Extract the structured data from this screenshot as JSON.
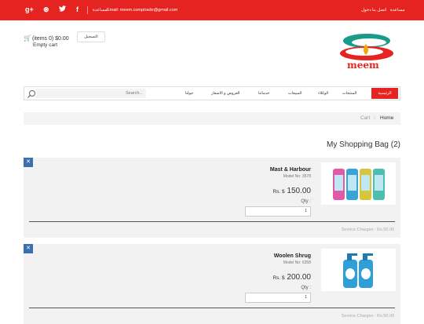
{
  "topbar": {
    "social": [
      {
        "name": "google-plus-icon",
        "glyph": "g+"
      },
      {
        "name": "dribbble-icon",
        "glyph": "⊛"
      },
      {
        "name": "twitter-icon",
        "glyph": "🐦"
      },
      {
        "name": "facebook-icon",
        "glyph": "f"
      }
    ],
    "help_link": "مساعدة",
    "email_link": "Email: meem.comptrade@gmail.com",
    "right_links": [
      "مساعدة",
      "اتصل بنا",
      "دخول"
    ]
  },
  "header": {
    "cart_summary": "(items 0) $0.00",
    "empty_cart": "Empty cart",
    "login_button": "التسجيل",
    "logo_text": "meem"
  },
  "nav": {
    "search_placeholder": "Search...",
    "items": [
      "جولنا",
      "العروض و الاسعار",
      "خدماتنا",
      "المبيعات",
      "الوكلاء",
      "المنتجات"
    ],
    "active": "الرئيسية"
  },
  "breadcrumb": {
    "home": "Home",
    "separator": "/",
    "current": "Cart"
  },
  "page": {
    "heading": "My Shopping Bag (2)"
  },
  "items": [
    {
      "name": "Mast & Harbour",
      "model": "Model No: 3578",
      "currency": "Rs. $",
      "price": "150.00",
      "qty_label": "Qty :",
      "qty": "1",
      "service": "Service Charges : Rs.50.00",
      "image": "shampoo-bottles"
    },
    {
      "name": "Woolen Shrug",
      "model": "Model No: 6358",
      "currency": "Rs. $",
      "price": "200.00",
      "qty_label": "Qty :",
      "qty": "1",
      "service": "Service Charges : Rs.50.00",
      "image": "soap-dispensers"
    }
  ],
  "colors": {
    "brand_red": "#e52421",
    "remove_blue": "#3a6fb0",
    "card_bg": "#f2f2f2"
  }
}
